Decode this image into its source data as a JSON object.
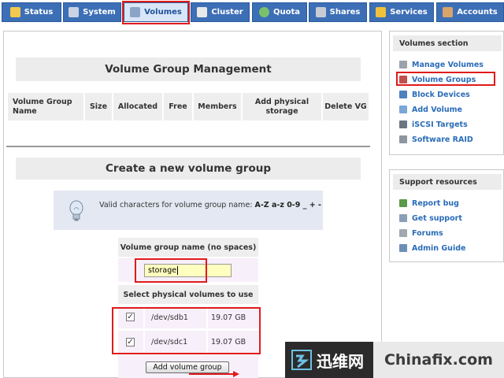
{
  "tabs": [
    {
      "id": "status",
      "label": "Status",
      "icon": "status-icon"
    },
    {
      "id": "system",
      "label": "System",
      "icon": "system-icon"
    },
    {
      "id": "volumes",
      "label": "Volumes",
      "icon": "volumes-icon",
      "active": true
    },
    {
      "id": "cluster",
      "label": "Cluster",
      "icon": "cluster-icon"
    },
    {
      "id": "quota",
      "label": "Quota",
      "icon": "quota-icon"
    },
    {
      "id": "shares",
      "label": "Shares",
      "icon": "shares-icon"
    },
    {
      "id": "services",
      "label": "Services",
      "icon": "services-icon"
    },
    {
      "id": "accounts",
      "label": "Accounts",
      "icon": "accounts-icon"
    }
  ],
  "main": {
    "title": "Volume Group Management",
    "table_headers": [
      "Volume Group Name",
      "Size",
      "Allocated",
      "Free",
      "Members",
      "Add physical storage",
      "Delete VG"
    ],
    "create_title": "Create a new volume group",
    "info": {
      "text": "Valid characters for volume group name:",
      "chars": "A-Z a-z 0-9 _ + -"
    },
    "form": {
      "name_label": "Volume group name (no spaces)",
      "name_value": "storage",
      "pv_label": "Select physical volumes to use",
      "physical_volumes": [
        {
          "device": "/dev/sdb1",
          "size": "19.07 GB",
          "checked": true
        },
        {
          "device": "/dev/sdc1",
          "size": "19.07 GB",
          "checked": true
        }
      ],
      "submit_label": "Add volume group"
    }
  },
  "sidebar": {
    "volumes_section_title": "Volumes section",
    "volumes_items": [
      {
        "label": "Manage Volumes",
        "icon": "disk-icon"
      },
      {
        "label": "Volume Groups",
        "icon": "volume-group-icon",
        "highlighted": true
      },
      {
        "label": "Block Devices",
        "icon": "block-device-icon"
      },
      {
        "label": "Add Volume",
        "icon": "add-volume-icon"
      },
      {
        "label": "iSCSI Targets",
        "icon": "iscsi-icon"
      },
      {
        "label": "Software RAID",
        "icon": "raid-icon"
      }
    ],
    "support_title": "Support resources",
    "support_items": [
      {
        "label": "Report bug",
        "icon": "bug-icon"
      },
      {
        "label": "Get support",
        "icon": "support-icon"
      },
      {
        "label": "Forums",
        "icon": "forum-icon"
      },
      {
        "label": "Admin Guide",
        "icon": "guide-icon"
      }
    ]
  },
  "watermark": {
    "cn": "迅维网",
    "en": "Chinafix.com"
  },
  "colors": {
    "tab_bg": "#3d6fb6",
    "tab_active_bg": "#d9e6f7",
    "link": "#2a6cb8",
    "highlight_box": "#e01b1b",
    "input_bg": "#ffffc0"
  }
}
